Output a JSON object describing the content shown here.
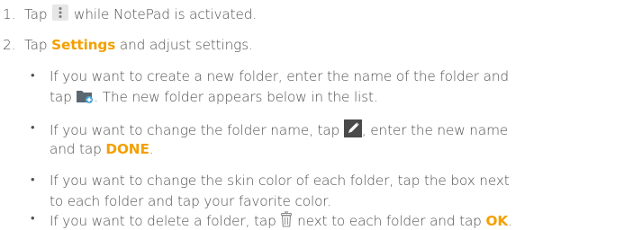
{
  "steps": [
    {
      "number": "1.",
      "pre": "Tap",
      "icon": "more-options-icon",
      "post": "while NotePad is activated."
    },
    {
      "number": "2.",
      "pre": "Tap",
      "highlight": "Settings",
      "post": "and adjust settings."
    }
  ],
  "bullets": [
    {
      "line1": "If you want to create a new folder, enter the name of the folder and",
      "line2_pre": "tap",
      "icon": "new-folder-icon",
      "line2_post": ". The new folder appears below in the list."
    },
    {
      "line1_pre": "If you want to change the folder name, tap",
      "icon": "edit-pencil-icon",
      "line1_post": ", enter the new name",
      "line2_pre": "and tap",
      "highlight": "DONE",
      "line2_post": "."
    },
    {
      "line1": "If you want to change the skin color of each folder, tap the box next",
      "line2": "to each folder and tap your favorite color."
    },
    {
      "line1_pre": "If you want to delete a folder, tap",
      "icon": "delete-bin-icon",
      "line1_mid": "next to each folder and tap",
      "highlight": "OK",
      "line1_post": "."
    }
  ],
  "bullet_glyph": "•",
  "colors": {
    "text": "#505050",
    "highlight": "#f3a000",
    "icon_dark": "#5a6770",
    "icon_accent": "#4aa5d9"
  }
}
